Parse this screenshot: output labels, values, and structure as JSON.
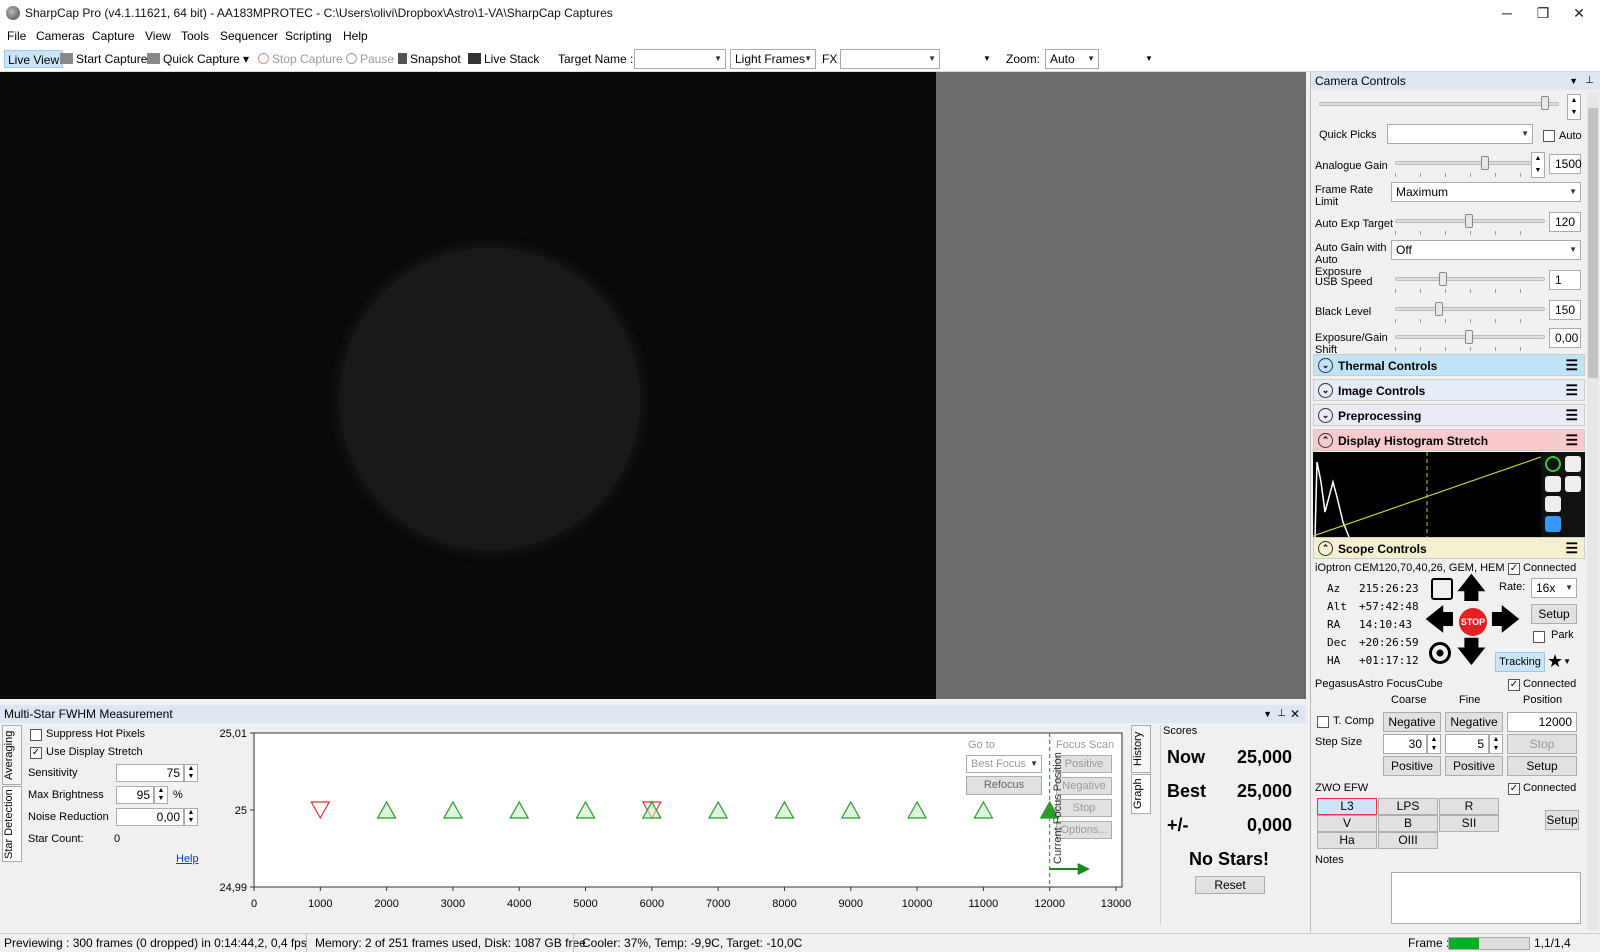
{
  "titlebar": {
    "title": "SharpCap Pro (v4.1.11621, 64 bit) - AA183MPROTEC - C:\\Users\\olivi\\Dropbox\\Astro\\1-VA\\SharpCap Captures",
    "minimize": "─",
    "maximize": "❐",
    "close": "✕"
  },
  "menu": [
    "File",
    "Cameras",
    "Capture",
    "View",
    "Tools",
    "Sequencer",
    "Scripting",
    "Help"
  ],
  "toolbar": {
    "live_view": "Live View",
    "start_capture": "Start Capture",
    "quick_capture": "Quick Capture",
    "stop_capture": "Stop Capture",
    "pause": "Pause",
    "snapshot": "Snapshot",
    "live_stack": "Live Stack",
    "target_name_label": "Target Name :",
    "target_name_value": "",
    "frame_type": "Light Frames",
    "fx_label": "FX",
    "fx_value": "",
    "zoom_label": "Zoom:",
    "zoom_value": "Auto"
  },
  "camera_controls": {
    "title": "Camera Controls",
    "quick_picks_label": "Quick Picks",
    "quick_picks_value": "",
    "auto_label": "Auto",
    "analogue_gain_label": "Analogue Gain",
    "analogue_gain": "1500",
    "frame_rate_label": "Frame Rate Limit",
    "frame_rate_value": "Maximum",
    "auto_exp_label": "Auto Exp Target",
    "auto_exp": "120",
    "auto_gain_label": "Auto Gain with Auto Exposure",
    "auto_gain_value": "Off",
    "usb_label": "USB Speed",
    "usb": "1",
    "black_label": "Black Level",
    "black": "150",
    "shift_label": "Exposure/Gain Shift",
    "shift": "0,00"
  },
  "sections": {
    "thermal": "Thermal Controls",
    "image": "Image Controls",
    "preprocessing": "Preprocessing",
    "histogram": "Display Histogram Stretch",
    "scope": "Scope Controls"
  },
  "colors": {
    "thermal": "#bfe3f7",
    "image": "#e6ecf5",
    "preprocessing": "#ebebf7",
    "histogram": "#f7c8cc",
    "scope": "#f5efd2",
    "accent": "#3399ff"
  },
  "scope": {
    "mount": "iOptron CEM120,70,40,26, GEM, HEM",
    "connected": "Connected",
    "az_label": "Az",
    "az": "215:26:23",
    "alt_label": "Alt",
    "alt": "+57:42:48",
    "ra_label": "RA",
    "ra": "14:10:43",
    "dec_label": "Dec",
    "dec": "+20:26:59",
    "ha_label": "HA",
    "ha": "+01:17:12",
    "rate_label": "Rate:",
    "rate": "16x",
    "setup": "Setup",
    "park": "Park",
    "tracking": "Tracking",
    "stop": "STOP"
  },
  "focuser": {
    "name": "PegasusAstro FocusCube",
    "connected": "Connected",
    "coarse": "Coarse",
    "fine": "Fine",
    "position_label": "Position",
    "tcomp": "T. Comp",
    "negative": "Negative",
    "position": "12000",
    "step_label": "Step Size",
    "step_coarse": "30",
    "step_fine": "5",
    "stop": "Stop",
    "positive": "Positive",
    "setup": "Setup"
  },
  "efw": {
    "name": "ZWO EFW",
    "connected": "Connected",
    "filters": [
      "L3",
      "LPS",
      "R",
      "V",
      "B",
      "SII",
      "Ha",
      "OIII"
    ],
    "setup": "Setup"
  },
  "notes_label": "Notes",
  "fwhm": {
    "title": "Multi-Star FWHM Measurement",
    "tab_averaging": "Averaging",
    "tab_star_detection": "Star Detection",
    "suppress_hot": "Suppress Hot Pixels",
    "use_display_stretch": "Use Display Stretch",
    "sensitivity_label": "Sensitivity",
    "sensitivity": "75",
    "max_brightness_label": "Max Brightness",
    "max_brightness": "95",
    "percent": "%",
    "noise_label": "Noise Reduction",
    "noise": "0,00",
    "star_count_label": "Star Count:",
    "star_count": "0",
    "help": "Help",
    "goto_label": "Go to",
    "best_focus": "Best Focus",
    "refocus": "Refocus",
    "focus_scan": "Focus Scan",
    "positive": "Positive",
    "negative": "Negative",
    "stop": "Stop",
    "options": "Options...",
    "current_focus_pos": "Current Focus Position",
    "tab_history": "History",
    "tab_graph": "Graph",
    "scores_label": "Scores",
    "now_label": "Now",
    "now": "25,000",
    "best_label": "Best",
    "best": "25,000",
    "pm_label": "+/-",
    "pm": "0,000",
    "no_stars": "No Stars!",
    "reset": "Reset"
  },
  "chart_data": {
    "type": "scatter",
    "x_ticks": [
      "0",
      "1000",
      "2000",
      "3000",
      "4000",
      "5000",
      "6000",
      "7000",
      "8000",
      "9000",
      "10000",
      "11000",
      "12000",
      "13000"
    ],
    "y_ticks": [
      "25,01",
      "25",
      "24,99"
    ],
    "xlim": [
      0,
      13000
    ],
    "ylim": [
      24.99,
      25.01
    ],
    "current_focus_position": 12000,
    "series": [
      {
        "marker": "triangle-down",
        "color": "#e03030",
        "x": [
          1000,
          6000
        ],
        "y": [
          25,
          25
        ]
      },
      {
        "marker": "triangle-up",
        "color": "#2a9a2a",
        "x": [
          2000,
          3000,
          4000,
          5000,
          6000,
          7000,
          8000,
          9000,
          10000,
          11000,
          12000
        ],
        "y": [
          25,
          25,
          25,
          25,
          25,
          25,
          25,
          25,
          25,
          25,
          25
        ]
      }
    ]
  },
  "status": {
    "preview": "Previewing : 300 frames (0 dropped) in 0:14:44,2, 0,4 fps",
    "memory": "Memory: 2 of 251 frames used, Disk: 1087 GB free",
    "cooler": "Cooler: 37%, Temp: -9,9C, Target: -10,0C",
    "frame_label": "Frame :",
    "frame_value": "1,1/1,4"
  }
}
